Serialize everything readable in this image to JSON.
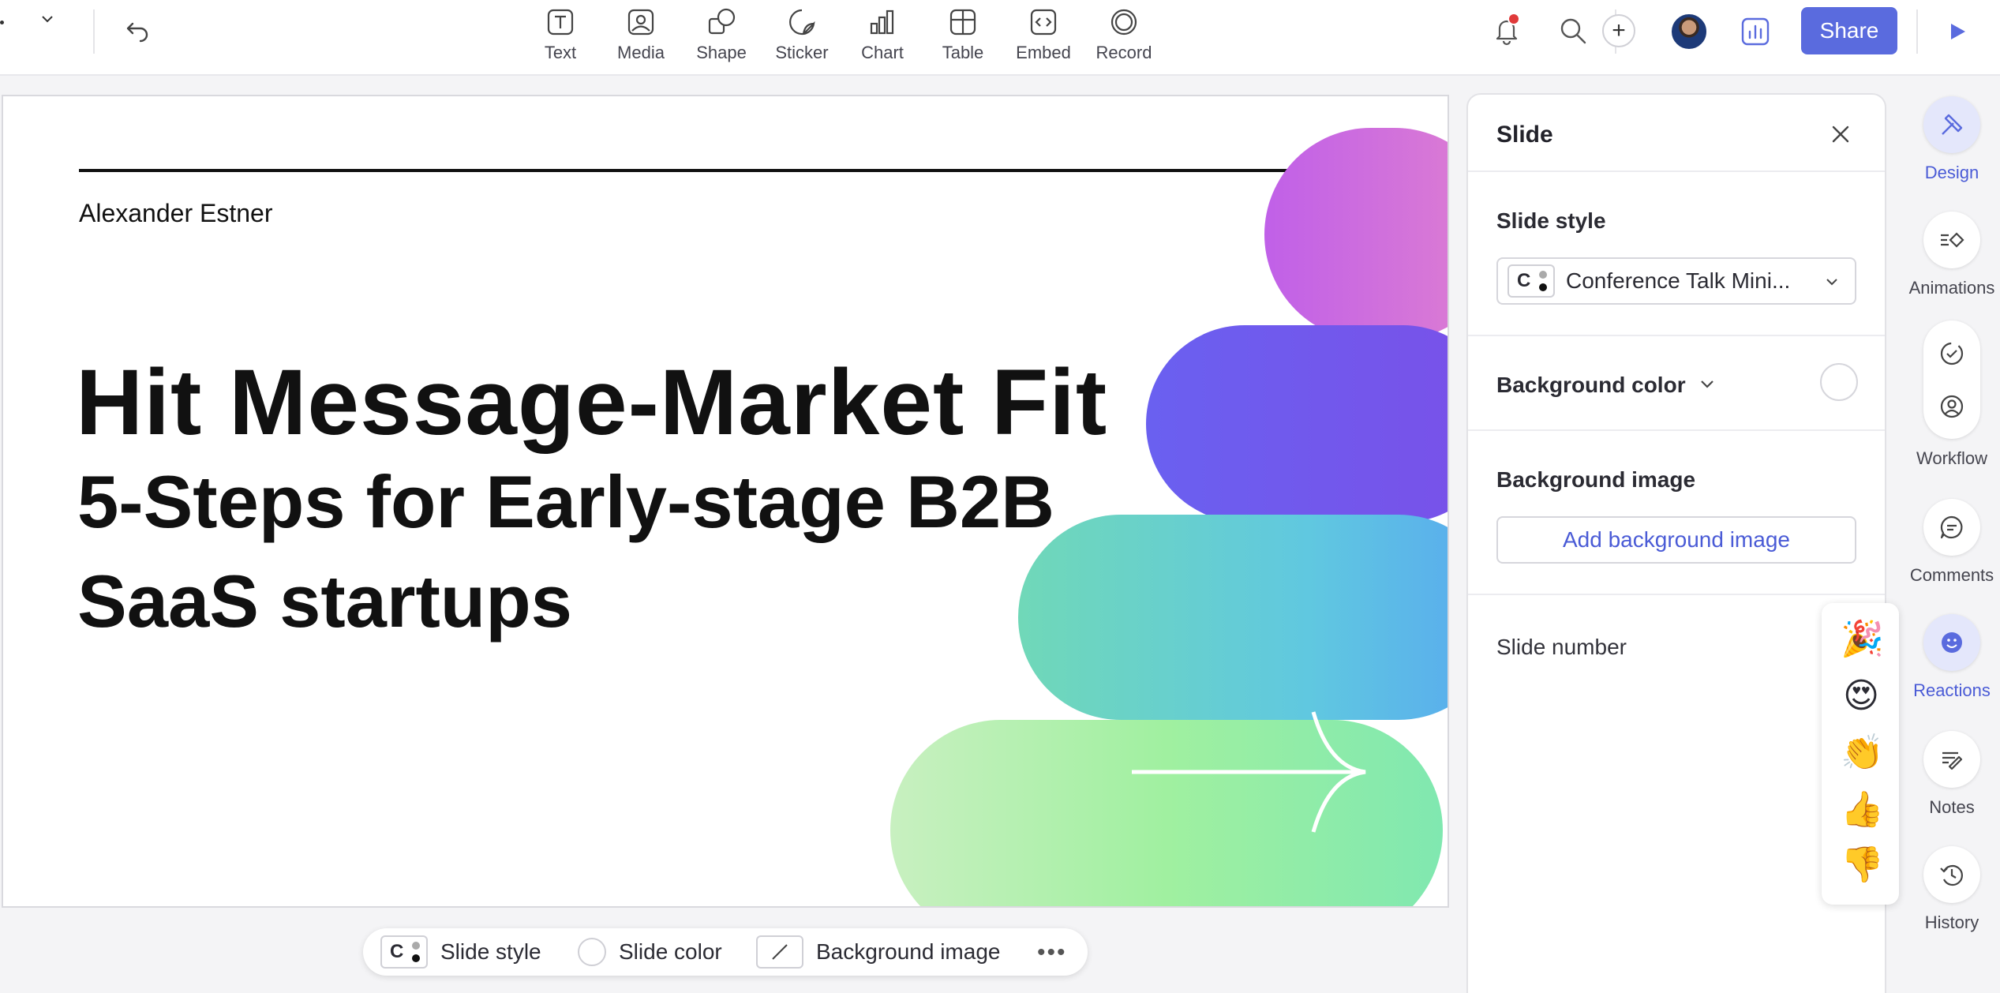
{
  "toolbar": {
    "tools": [
      {
        "label": "Text",
        "icon": "text-icon"
      },
      {
        "label": "Media",
        "icon": "media-icon"
      },
      {
        "label": "Shape",
        "icon": "shape-icon"
      },
      {
        "label": "Sticker",
        "icon": "sticker-icon"
      },
      {
        "label": "Chart",
        "icon": "chart-icon"
      },
      {
        "label": "Table",
        "icon": "table-icon"
      },
      {
        "label": "Embed",
        "icon": "embed-icon"
      },
      {
        "label": "Record",
        "icon": "record-icon"
      }
    ],
    "share_label": "Share",
    "add_symbol": "+"
  },
  "slide": {
    "author": "Alexander Estner",
    "title": "Hit Message-Market Fit",
    "subtitle_line1": "5-Steps for Early-stage B2B",
    "subtitle_line2": "SaaS startups"
  },
  "bottom_toolbar": {
    "slide_style": "Slide style",
    "slide_color": "Slide color",
    "background_image": "Background image",
    "swatch_letter": "C",
    "more": "•••"
  },
  "panel": {
    "title": "Slide",
    "slide_style_label": "Slide style",
    "slide_style_value": "Conference Talk Mini...",
    "swatch_letter": "C",
    "background_color_label": "Background color",
    "background_image_label": "Background image",
    "add_background_label": "Add background image",
    "slide_number_label": "Slide number"
  },
  "reactions": {
    "emojis": [
      "🎉",
      "😍",
      "👏",
      "👍",
      "👎"
    ]
  },
  "rail": {
    "design": "Design",
    "animations": "Animations",
    "workflow": "Workflow",
    "comments": "Comments",
    "reactions": "Reactions",
    "notes": "Notes",
    "history": "History"
  },
  "colors": {
    "accent": "#5a6bde",
    "notification": "#e03a3a"
  }
}
